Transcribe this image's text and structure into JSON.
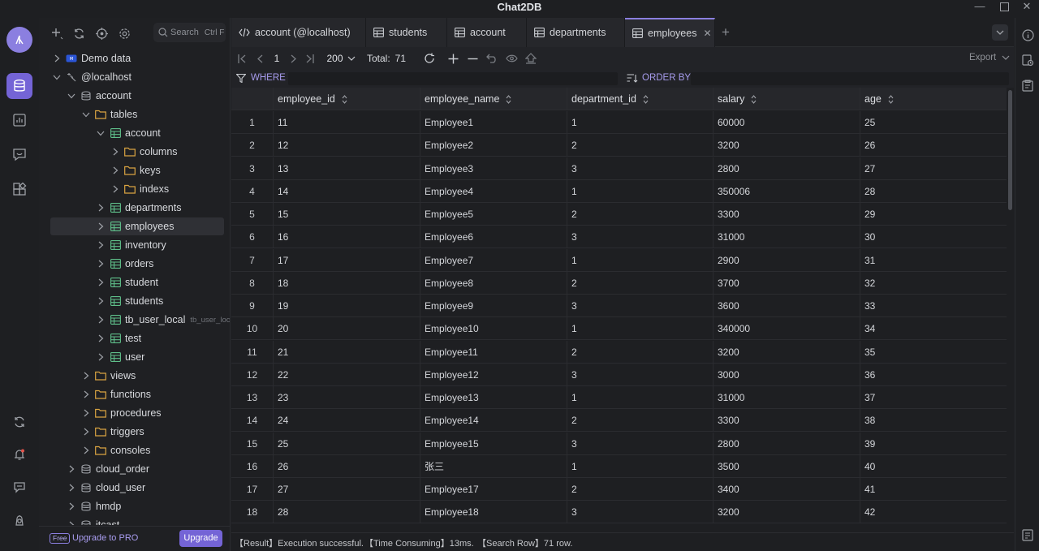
{
  "window": {
    "title": "Chat2DB"
  },
  "colors": {
    "accent": "#7464d6",
    "folder": "#d9a441",
    "table": "#5fbf8a",
    "background": "#1e1f22"
  },
  "sidebar": {
    "search_placeholder": "Search",
    "search_shortcut": "Ctrl F",
    "tree": [
      {
        "label": "Demo data",
        "level": 0,
        "expanded": false,
        "icon": "demo-db-icon"
      },
      {
        "label": "@localhost",
        "level": 0,
        "expanded": true,
        "icon": "connection-icon"
      },
      {
        "label": "account",
        "level": 1,
        "expanded": true,
        "icon": "database-icon"
      },
      {
        "label": "tables",
        "level": 2,
        "expanded": true,
        "icon": "folder-icon"
      },
      {
        "label": "account",
        "level": 3,
        "expanded": true,
        "icon": "table-icon"
      },
      {
        "label": "columns",
        "level": 4,
        "expanded": false,
        "icon": "folder-icon"
      },
      {
        "label": "keys",
        "level": 4,
        "expanded": false,
        "icon": "folder-icon"
      },
      {
        "label": "indexs",
        "level": 4,
        "expanded": false,
        "icon": "folder-icon"
      },
      {
        "label": "departments",
        "level": 3,
        "expanded": false,
        "icon": "table-icon"
      },
      {
        "label": "employees",
        "level": 3,
        "expanded": false,
        "icon": "table-icon",
        "selected": true
      },
      {
        "label": "inventory",
        "level": 3,
        "expanded": false,
        "icon": "table-icon"
      },
      {
        "label": "orders",
        "level": 3,
        "expanded": false,
        "icon": "table-icon"
      },
      {
        "label": "student",
        "level": 3,
        "expanded": false,
        "icon": "table-icon"
      },
      {
        "label": "students",
        "level": 3,
        "expanded": false,
        "icon": "table-icon"
      },
      {
        "label": "tb_user_local",
        "sub": "tb_user_loca",
        "level": 3,
        "expanded": false,
        "icon": "table-icon"
      },
      {
        "label": "test",
        "level": 3,
        "expanded": false,
        "icon": "table-icon"
      },
      {
        "label": "user",
        "level": 3,
        "expanded": false,
        "icon": "table-icon"
      },
      {
        "label": "views",
        "level": 2,
        "expanded": false,
        "icon": "folder-icon"
      },
      {
        "label": "functions",
        "level": 2,
        "expanded": false,
        "icon": "folder-icon"
      },
      {
        "label": "procedures",
        "level": 2,
        "expanded": false,
        "icon": "folder-icon"
      },
      {
        "label": "triggers",
        "level": 2,
        "expanded": false,
        "icon": "folder-icon"
      },
      {
        "label": "consoles",
        "level": 2,
        "expanded": false,
        "icon": "folder-icon"
      },
      {
        "label": "cloud_order",
        "level": 1,
        "expanded": false,
        "icon": "database-icon"
      },
      {
        "label": "cloud_user",
        "level": 1,
        "expanded": false,
        "icon": "database-icon"
      },
      {
        "label": "hmdp",
        "level": 1,
        "expanded": false,
        "icon": "database-icon"
      },
      {
        "label": "itcast",
        "level": 1,
        "expanded": false,
        "icon": "database-icon"
      }
    ],
    "free_badge": "Free",
    "upgrade_text": "Upgrade to PRO",
    "upgrade_button": "Upgrade"
  },
  "tabs": [
    {
      "label": "account (@localhost)",
      "icon": "code-icon",
      "active": false
    },
    {
      "label": "students",
      "icon": "table-icon",
      "active": false
    },
    {
      "label": "account",
      "icon": "table-icon",
      "active": false
    },
    {
      "label": "departments",
      "icon": "table-icon",
      "active": false
    },
    {
      "label": "employees",
      "icon": "table-icon",
      "active": true
    }
  ],
  "toolbar": {
    "page": "1",
    "page_size": "200",
    "total_label": "Total:",
    "total_value": "71",
    "export_label": "Export"
  },
  "filter": {
    "where_label": "WHERE",
    "orderby_label": "ORDER BY"
  },
  "grid": {
    "columns": [
      "employee_id",
      "employee_name",
      "department_id",
      "salary",
      "age"
    ],
    "rows": [
      [
        "1",
        "11",
        "Employee1",
        "1",
        "60000",
        "25"
      ],
      [
        "2",
        "12",
        "Employee2",
        "2",
        "3200",
        "26"
      ],
      [
        "3",
        "13",
        "Employee3",
        "3",
        "2800",
        "27"
      ],
      [
        "4",
        "14",
        "Employee4",
        "1",
        "350006",
        "28"
      ],
      [
        "5",
        "15",
        "Employee5",
        "2",
        "3300",
        "29"
      ],
      [
        "6",
        "16",
        "Employee6",
        "3",
        "31000",
        "30"
      ],
      [
        "7",
        "17",
        "Employee7",
        "1",
        "2900",
        "31"
      ],
      [
        "8",
        "18",
        "Employee8",
        "2",
        "3700",
        "32"
      ],
      [
        "9",
        "19",
        "Employee9",
        "3",
        "3600",
        "33"
      ],
      [
        "10",
        "20",
        "Employee10",
        "1",
        "340000",
        "34"
      ],
      [
        "11",
        "21",
        "Employee11",
        "2",
        "3200",
        "35"
      ],
      [
        "12",
        "22",
        "Employee12",
        "3",
        "3000",
        "36"
      ],
      [
        "13",
        "23",
        "Employee13",
        "1",
        "31000",
        "37"
      ],
      [
        "14",
        "24",
        "Employee14",
        "2",
        "3300",
        "38"
      ],
      [
        "15",
        "25",
        "Employee15",
        "3",
        "2800",
        "39"
      ],
      [
        "16",
        "26",
        "张三",
        "1",
        "3500",
        "40"
      ],
      [
        "17",
        "27",
        "Employee17",
        "2",
        "3400",
        "41"
      ],
      [
        "18",
        "28",
        "Employee18",
        "3",
        "3200",
        "42"
      ]
    ]
  },
  "status": {
    "result": "【Result】Execution successful.",
    "time": "【Time Consuming】13ms.",
    "search_row": "【Search Row】71 row."
  }
}
